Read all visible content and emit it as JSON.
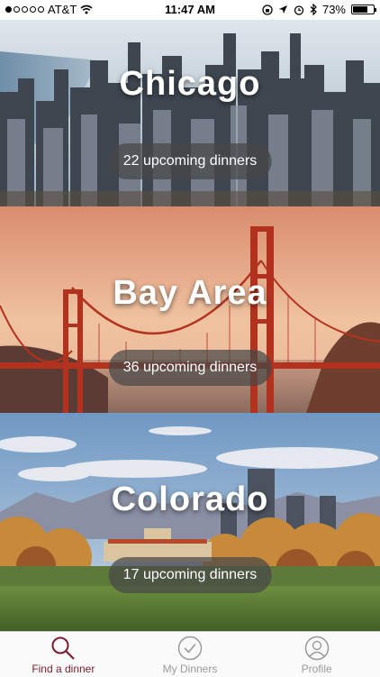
{
  "status_bar": {
    "carrier": "AT&T",
    "time": "11:47 AM",
    "battery": "73%",
    "battery_level": 0.73,
    "icons": [
      "signal-dots-icon",
      "wifi-icon",
      "orientation-lock-icon",
      "location-icon",
      "alarm-icon",
      "bluetooth-icon",
      "battery-icon"
    ]
  },
  "cities": [
    {
      "name": "Chicago",
      "upcoming": "22 upcoming dinners"
    },
    {
      "name": "Bay Area",
      "upcoming": "36 upcoming dinners"
    },
    {
      "name": "Colorado",
      "upcoming": "17 upcoming dinners"
    }
  ],
  "tabs": [
    {
      "label": "Find a dinner",
      "icon": "search-icon",
      "active": true
    },
    {
      "label": "My Dinners",
      "icon": "check-circle-icon",
      "active": false
    },
    {
      "label": "Profile",
      "icon": "profile-icon",
      "active": false
    }
  ],
  "colors": {
    "accent": "#7a1d2e",
    "inactive": "#9a9a9a"
  }
}
